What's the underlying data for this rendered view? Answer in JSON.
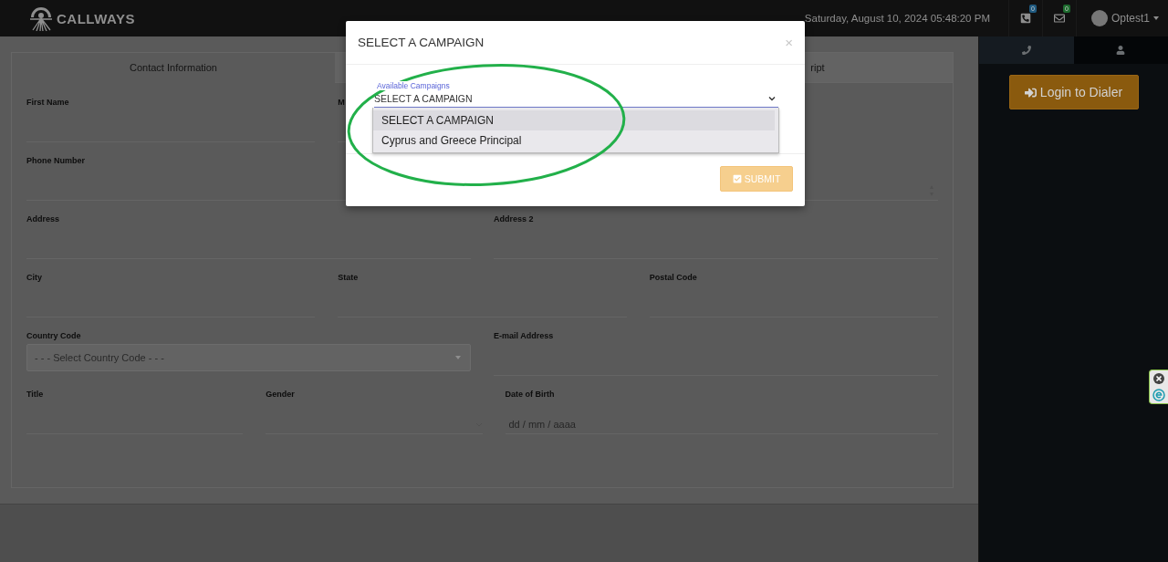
{
  "header": {
    "logo": "CALLWAYS",
    "datetime": "Saturday, August 10, 2024 05:48:20 PM",
    "calls_badge": "0",
    "mail_badge": "0",
    "user": "Optest1"
  },
  "tabs": [
    {
      "label": "Contact Information",
      "selected": true
    },
    {
      "selected": false
    },
    {
      "label": "ript",
      "selected": false
    }
  ],
  "form_rows": [
    {
      "kind": "thirds",
      "fields": [
        {
          "label": "First Name",
          "kind": "text"
        },
        {
          "label": "M",
          "kind": "text"
        }
      ]
    },
    {
      "kind": "halves",
      "fields": [
        {
          "label": "Phone Number",
          "kind": "text"
        },
        {
          "kind": "number"
        }
      ]
    },
    {
      "kind": "halves",
      "fields": [
        {
          "label": "Address",
          "kind": "text"
        },
        {
          "label": "Address 2",
          "kind": "text"
        }
      ]
    },
    {
      "kind": "thirds",
      "fields": [
        {
          "label": "City",
          "kind": "text"
        },
        {
          "label": "State",
          "kind": "text"
        },
        {
          "label": "Postal Code",
          "kind": "text"
        }
      ]
    },
    {
      "kind": "halves",
      "fields": [
        {
          "label": "Country Code",
          "kind": "select",
          "value": "- - - Select Country Code - - -"
        },
        {
          "label": "E-mail Address",
          "kind": "text"
        }
      ]
    },
    {
      "kind": "split",
      "fields": [
        {
          "label": "Title",
          "kind": "text"
        },
        {
          "label": "Gender",
          "kind": "dropdown"
        },
        {
          "label": "Date of Birth",
          "kind": "date",
          "placeholder": "dd / mm / aaaa"
        }
      ]
    }
  ],
  "side_tabs": [
    {
      "kind": "phone",
      "selected": true
    },
    {
      "kind": "user",
      "selected": false
    }
  ],
  "login_button": "Login to Dialer",
  "modal": {
    "title": "SELECT A CAMPAIGN",
    "field_label": "Available Campaigns",
    "value": "SELECT A CAMPAIGN",
    "options": [
      {
        "label": "SELECT A CAMPAIGN",
        "selected": true
      },
      {
        "label": "Cyprus and Greece Principal",
        "selected": false
      }
    ],
    "close": "×",
    "submit": "SUBMIT"
  }
}
